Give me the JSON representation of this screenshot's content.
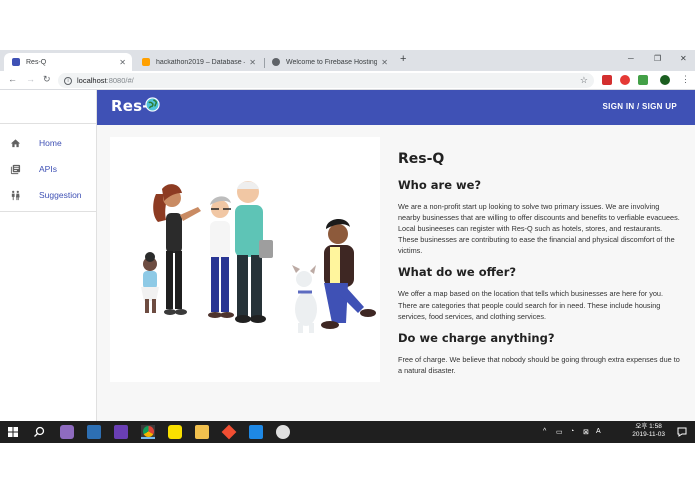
{
  "browser": {
    "tabs": [
      {
        "title": "Res-Q",
        "active": true,
        "favicon_color": "#3f51b5"
      },
      {
        "title": "hackathon2019 – Database – Fi",
        "active": false,
        "favicon_color": "#ffa000"
      },
      {
        "title": "Welcome to Firebase Hosting",
        "active": false,
        "favicon_color": "#5f6368"
      }
    ],
    "tab_close": "✕",
    "new_tab": "+",
    "window_controls": {
      "minimize": "─",
      "maximize": "❐",
      "close": "✕"
    },
    "nav": {
      "back": "←",
      "forward": "→",
      "reload": "↻"
    },
    "address": {
      "host": "localhost",
      "path": ":8080/#/",
      "info": "i",
      "star": "☆"
    },
    "extensions_colors": [
      "#d32f2f",
      "#e53935",
      "#43a047",
      "#1b5e20"
    ],
    "menu": "⋮"
  },
  "app": {
    "brand": "Res-",
    "appbar_color": "#3f51b5",
    "signin_label": "SIGN IN / SIGN UP",
    "drawer": [
      {
        "label": "Home",
        "icon": "home-icon"
      },
      {
        "label": "APIs",
        "icon": "library-icon"
      },
      {
        "label": "Suggestion",
        "icon": "people-icon"
      }
    ],
    "article": {
      "title": "Res-Q",
      "sections": [
        {
          "heading": "Who are we?",
          "body": "We are a non-profit start up looking to solve two primary issues. We are involving nearby businesses that are willing to offer discounts and benefits to verfiable evacuees. Local busineeses can register with Res-Q such as hotels, stores, and restaurants. These businesses are contributing to ease the financial and physical discomfort of the victims."
        },
        {
          "heading": "What do we offer?",
          "body": "We offer a map based on the location that tells which businesses are here for you. There are categories that people could search for in need. These include housing services, food services, and clothing services."
        },
        {
          "heading": "Do we charge anything?",
          "body": "Free of charge. We believe that nobody should be going through extra expenses due to a natural disaster."
        }
      ]
    }
  },
  "taskbar": {
    "clock_ampm_time": "오후 1:58",
    "clock_date": "2019-11-03",
    "tray": [
      "^",
      "▭",
      "◔",
      "⊠",
      "A"
    ]
  }
}
